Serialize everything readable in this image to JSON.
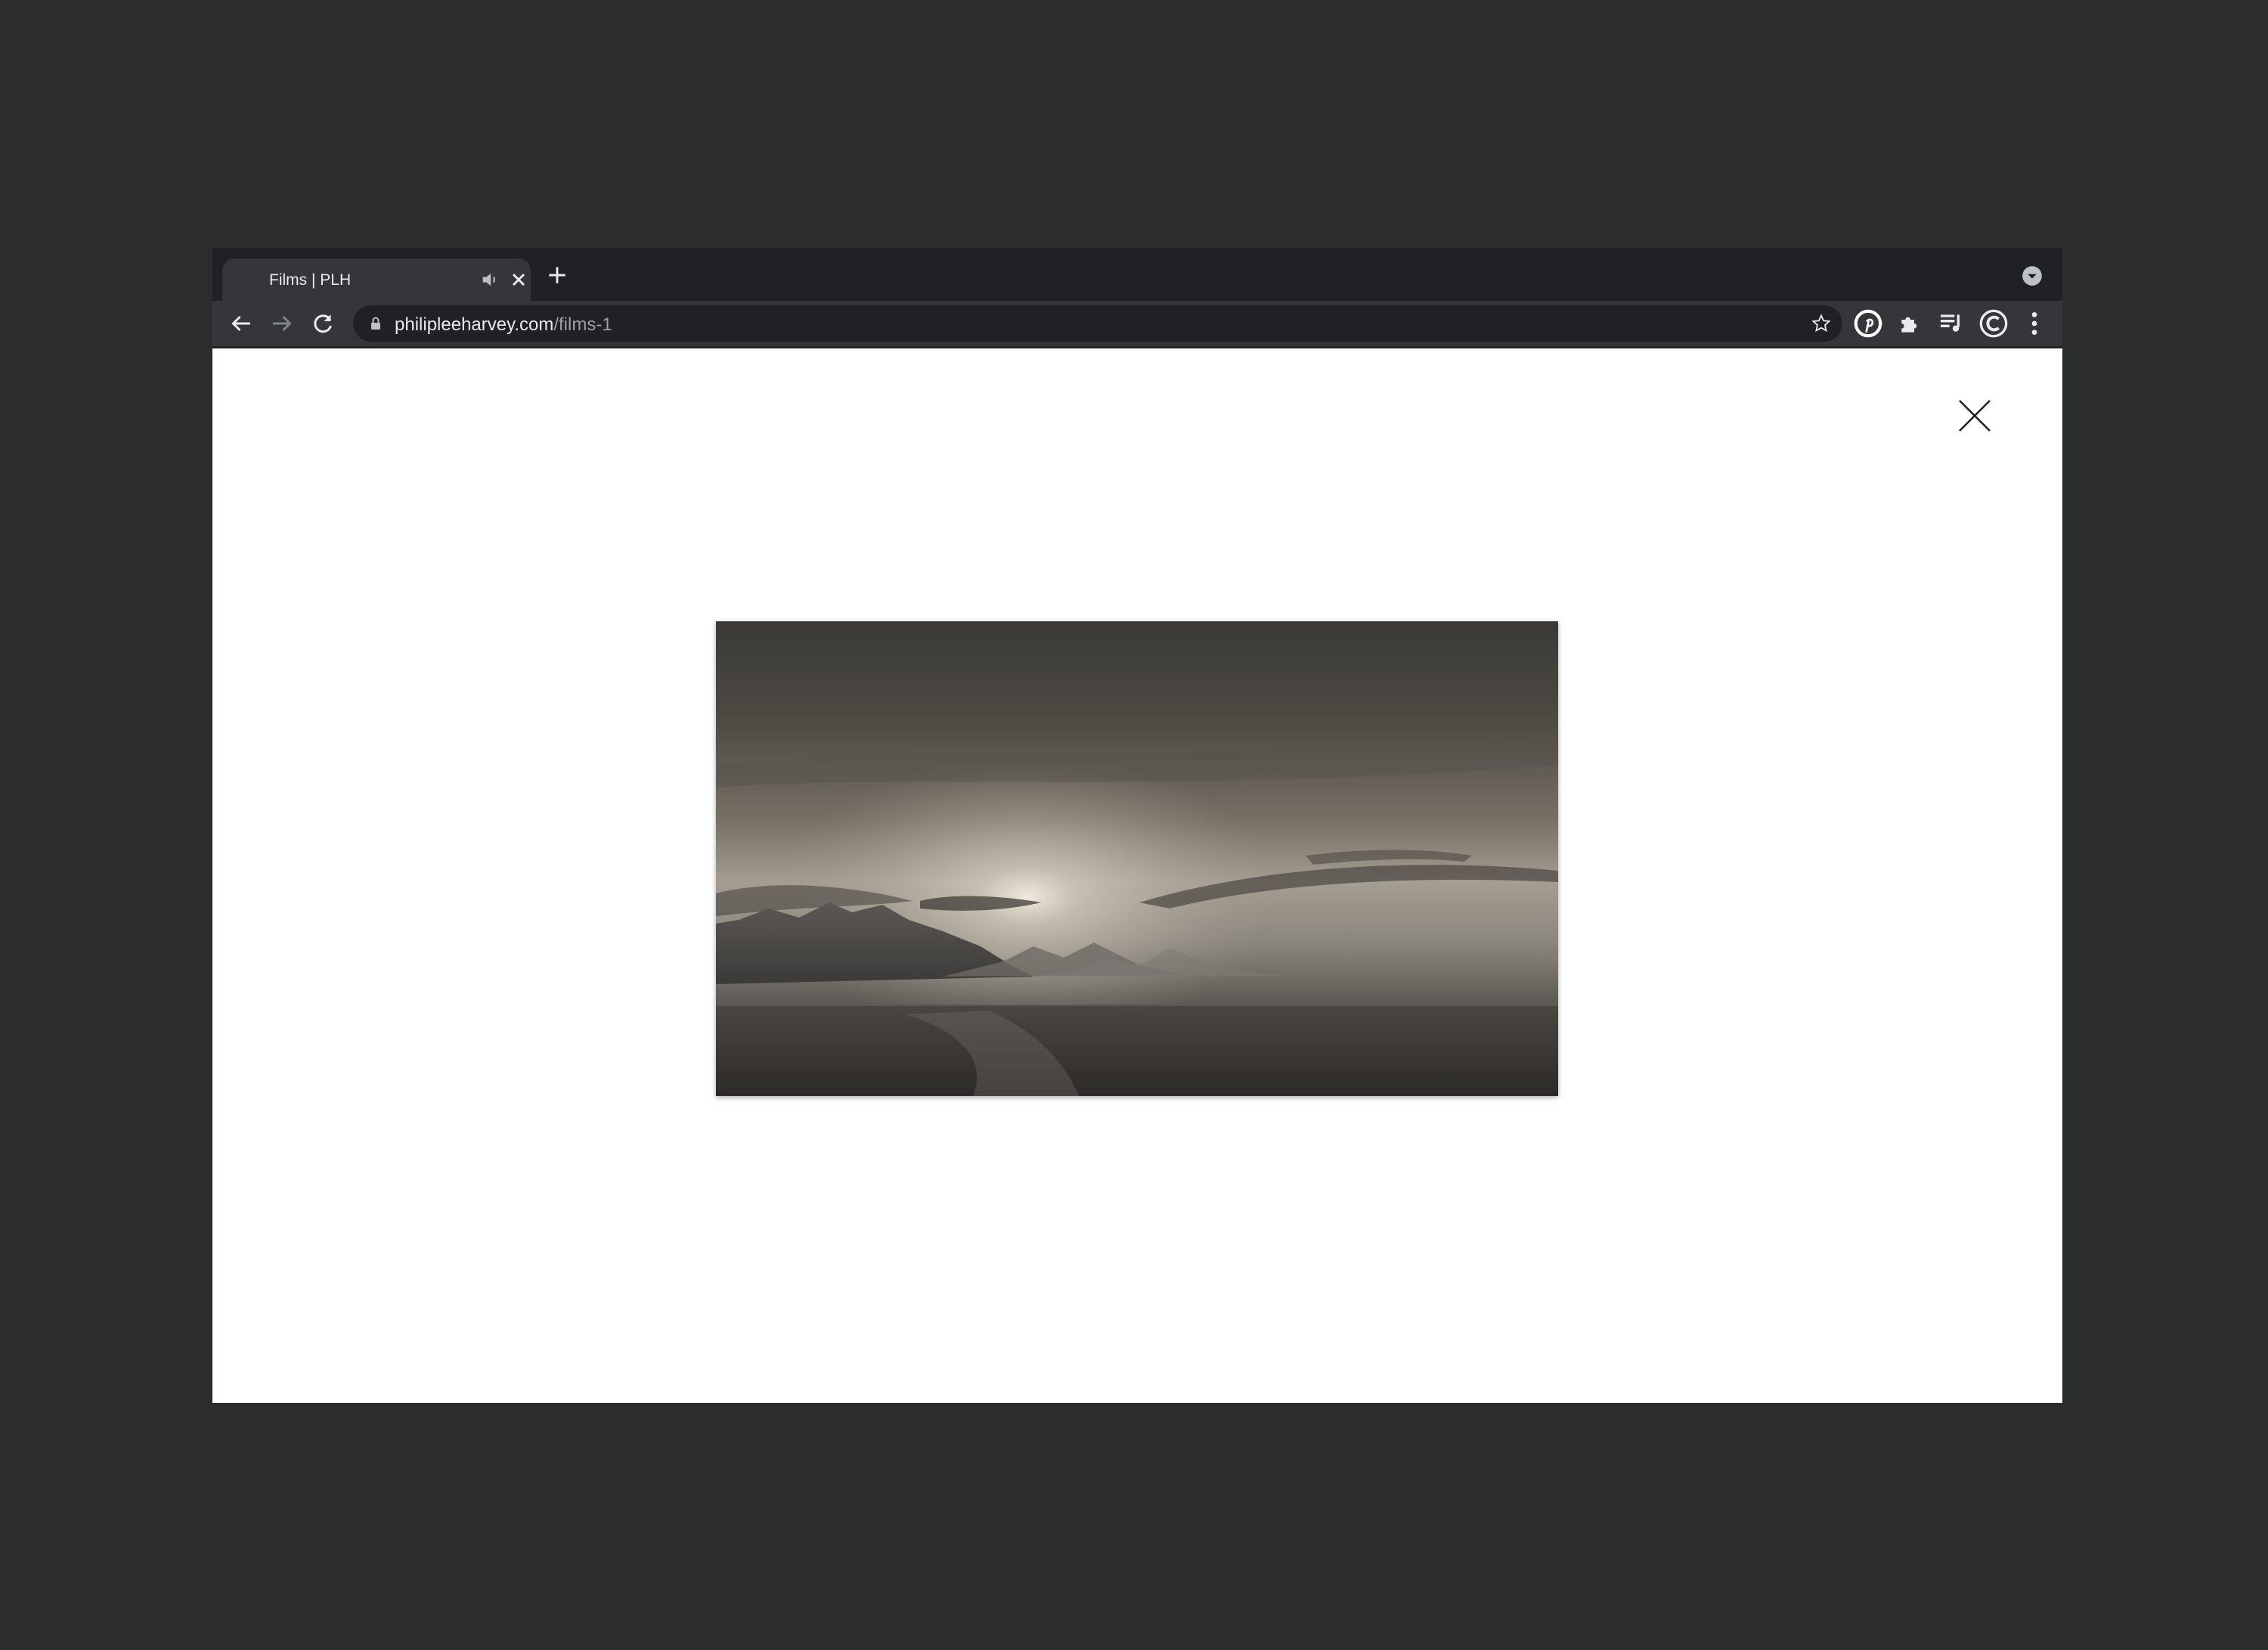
{
  "browser": {
    "tab": {
      "title": "Films | PLH"
    },
    "address_bar": {
      "domain": "philipleeharvey.com",
      "path": "/films-1"
    }
  },
  "icons": {
    "tab_audio": "speaker-icon",
    "tab_close": "close-icon",
    "new_tab": "plus-icon",
    "tab_search": "chevron-down-icon",
    "back": "arrow-left-icon",
    "forward": "arrow-right-icon",
    "reload": "reload-icon",
    "lock": "lock-icon",
    "bookmark": "star-icon",
    "pinterest": "pinterest-icon",
    "extensions": "puzzle-icon",
    "media": "playlist-icon",
    "extension_c": "c-logo-icon",
    "menu": "kebab-menu-icon",
    "lightbox_close": "x-icon"
  },
  "colors": {
    "frame": "#202124",
    "toolbar": "#35363a",
    "page_background": "#ffffff",
    "outer_background": "#2a2d2c"
  }
}
